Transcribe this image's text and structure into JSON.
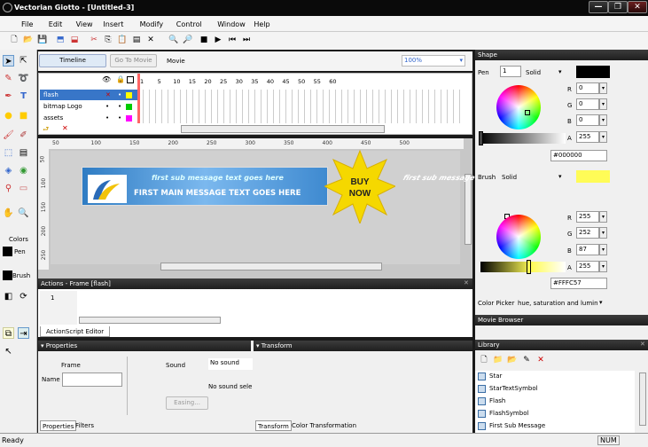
{
  "app": {
    "title": "Vectorian Giotto - [Untitled-3]"
  },
  "window": {
    "minimize": "—",
    "restore": "❐",
    "close": "✕"
  },
  "menu": [
    "File",
    "Edit",
    "View",
    "Insert",
    "Modify",
    "Control",
    "Window",
    "Help"
  ],
  "timeline": {
    "tab": "Timeline",
    "goto": "Go To Movie",
    "scene": "Movie",
    "zoom": "100%",
    "frame_numbers": [
      "1",
      "5",
      "10",
      "15",
      "20",
      "25",
      "30",
      "35",
      "40",
      "45",
      "50",
      "55",
      "60"
    ],
    "layers": [
      "flash",
      "bitmap Logo",
      "assets"
    ]
  },
  "stage": {
    "ruler": [
      "50",
      "100",
      "150",
      "200",
      "250",
      "300",
      "350",
      "400",
      "450",
      "500"
    ],
    "vruler": [
      "50",
      "100",
      "150",
      "200",
      "250"
    ],
    "sub_text": "first sub message text goes here",
    "main_text": "FIRST MAIN MESSAGE TEXT GOES HERE",
    "buy1": "BUY",
    "buy2": "NOW",
    "ghost": "first sub message"
  },
  "actions": {
    "title": "Actions - Frame [flash]",
    "line": "1",
    "tab": "ActionScript Editor"
  },
  "properties": {
    "title": "Properties",
    "frame": "Frame",
    "name_label": "Name",
    "name_value": "",
    "sound_label": "Sound",
    "sound_value": "No sound",
    "no_sound_sel": "No sound sele",
    "easing": "Easing...",
    "tab1": "Properties",
    "tab2": "Filters"
  },
  "transform": {
    "title": "Transform",
    "tab1": "Transform",
    "tab2": "Color Transformation"
  },
  "shape": {
    "title": "Shape",
    "pen_label": "Pen",
    "pen_width": "1",
    "pen_style": "Solid",
    "pen_color": "#000000",
    "r": "0",
    "g": "0",
    "b": "0",
    "a": "255",
    "pen_hex": "#000000",
    "brush_label": "Brush",
    "brush_style": "Solid",
    "brush_color": "#FFFC57",
    "br": "255",
    "bg": "252",
    "bb": "87",
    "ba": "255",
    "brush_hex": "#FFFC57",
    "picker_label": "Color Picker",
    "picker_value": "hue, saturation and lumin",
    "R": "R",
    "G": "G",
    "B": "B",
    "A": "A"
  },
  "movie_browser": {
    "title": "Movie Browser"
  },
  "library": {
    "title": "Library",
    "items": [
      "Star",
      "StarTextSymbol",
      "Flash",
      "FlashSymbol",
      "First Sub Message"
    ]
  },
  "colors": {
    "label": "Colors",
    "pen": "Pen",
    "brush": "Brush"
  },
  "status": {
    "left": "Ready",
    "num": "NUM"
  }
}
